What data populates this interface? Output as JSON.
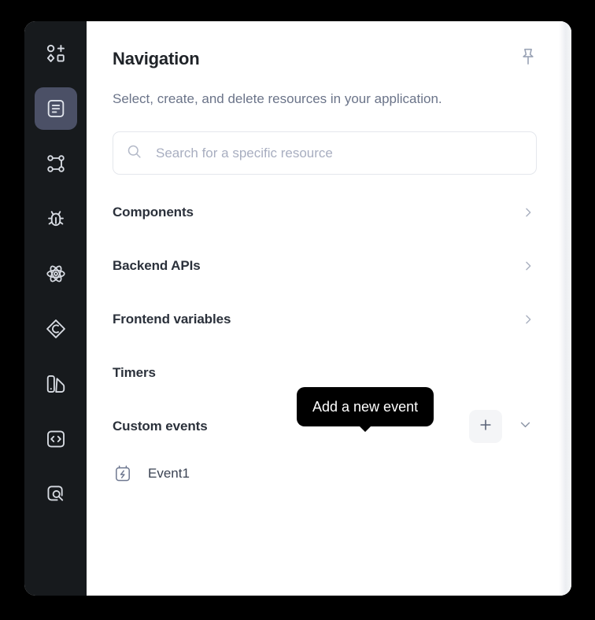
{
  "window": {
    "background": "#000000",
    "panel_background": "#ffffff",
    "rail_background": "#171a1d",
    "active_rail_background": "#4b5066",
    "accent_text": "#6b7489"
  },
  "rail": {
    "items": [
      {
        "id": "components",
        "icon": "shapes-add-icon",
        "label": "Components",
        "active": false
      },
      {
        "id": "navigation",
        "icon": "document-list-icon",
        "label": "Navigation",
        "active": true
      },
      {
        "id": "state-graph",
        "icon": "node-graph-icon",
        "label": "State graph",
        "active": false
      },
      {
        "id": "debugger",
        "icon": "bug-icon",
        "label": "Debugger",
        "active": false
      },
      {
        "id": "react",
        "icon": "atom-icon",
        "label": "React",
        "active": false
      },
      {
        "id": "data-source",
        "icon": "diamond-data-icon",
        "label": "Data source",
        "active": false
      },
      {
        "id": "theme",
        "icon": "palette-icon",
        "label": "Theme",
        "active": false
      },
      {
        "id": "code",
        "icon": "code-brackets-icon",
        "label": "Code",
        "active": false
      },
      {
        "id": "inspect",
        "icon": "search-square-icon",
        "label": "Inspect",
        "active": false
      }
    ]
  },
  "header": {
    "title": "Navigation",
    "pin_icon": "pushpin-icon",
    "subtitle": "Select, create, and delete resources in your application."
  },
  "search": {
    "icon": "search-icon",
    "value": "",
    "placeholder": "Search for a specific resource"
  },
  "resources": {
    "rows": [
      {
        "label": "Components",
        "type": "expandable",
        "chevron": "chevron-right-icon"
      },
      {
        "label": "Backend APIs",
        "type": "expandable",
        "chevron": "chevron-right-icon"
      },
      {
        "label": "Frontend variables",
        "type": "expandable",
        "chevron": "chevron-right-icon"
      },
      {
        "label": "Timers",
        "type": "plain",
        "chevron": ""
      },
      {
        "label": "Custom events",
        "type": "actions",
        "chevron": "chevron-down-icon"
      }
    ],
    "custom_events": {
      "add_label": "+",
      "add_icon": "plus-icon",
      "collapse_icon": "chevron-down-icon",
      "children": [
        {
          "icon": "event-bolt-icon",
          "label": "Event1"
        }
      ]
    }
  },
  "tooltip": {
    "text": "Add a new event",
    "background": "#000000",
    "color": "#ffffff"
  }
}
